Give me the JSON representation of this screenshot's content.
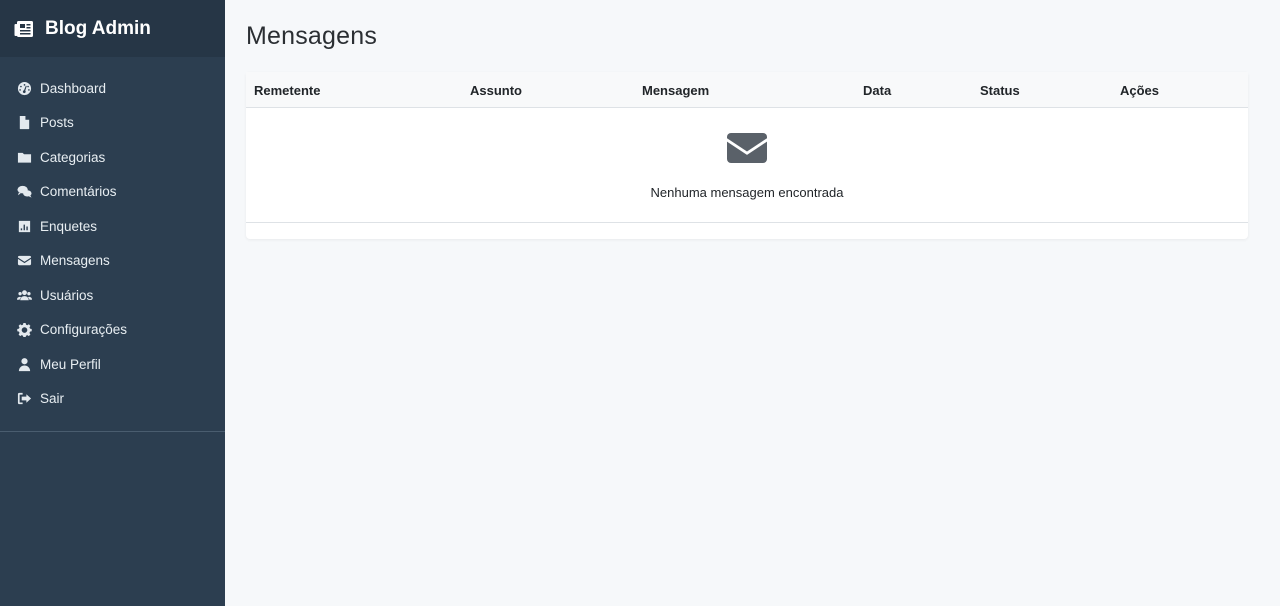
{
  "brand": {
    "title": "Blog Admin",
    "icon": "newspaper-icon"
  },
  "sidebar": {
    "items": [
      {
        "label": "Dashboard",
        "icon": "dashboard-icon"
      },
      {
        "label": "Posts",
        "icon": "file-icon"
      },
      {
        "label": "Categorias",
        "icon": "folder-icon"
      },
      {
        "label": "Comentários",
        "icon": "comments-icon"
      },
      {
        "label": "Enquetes",
        "icon": "chart-icon"
      },
      {
        "label": "Mensagens",
        "icon": "envelope-icon"
      },
      {
        "label": "Usuários",
        "icon": "users-icon"
      },
      {
        "label": "Configurações",
        "icon": "gear-icon"
      },
      {
        "label": "Meu Perfil",
        "icon": "user-icon"
      },
      {
        "label": "Sair",
        "icon": "logout-icon"
      }
    ]
  },
  "page": {
    "title": "Mensagens"
  },
  "table": {
    "columns": [
      "Remetente",
      "Assunto",
      "Mensagem",
      "Data",
      "Status",
      "Ações"
    ],
    "empty_message": "Nenhuma mensagem encontrada",
    "empty_icon": "envelope-icon"
  },
  "colors": {
    "sidebar_bg": "#2c3e50",
    "brand_bg": "#263646",
    "page_bg": "#f6f8fa",
    "icon_gray": "#5a6169"
  }
}
